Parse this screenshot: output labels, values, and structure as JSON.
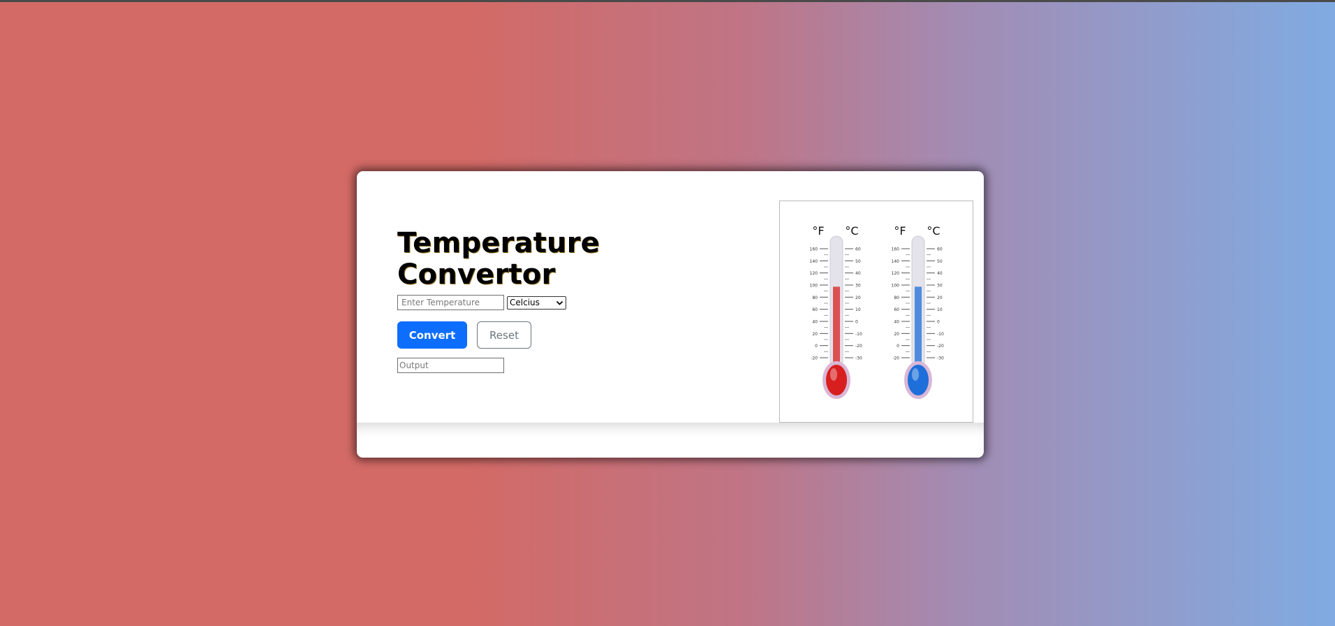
{
  "app": {
    "title": "Temperature Convertor"
  },
  "form": {
    "temperature_placeholder": "Enter Temperature",
    "temperature_value": "",
    "unit_selected": "Celcius",
    "convert_label": "Convert",
    "reset_label": "Reset",
    "output_placeholder": "Output",
    "output_value": ""
  },
  "illustration": {
    "thermometers": [
      {
        "scale_left": "°F",
        "scale_right": "°C",
        "color": "#d81f1f",
        "fill_fraction": 0.68
      },
      {
        "scale_left": "°F",
        "scale_right": "°C",
        "color": "#1e6fd9",
        "fill_fraction": 0.68
      }
    ],
    "fahrenheit_ticks": [
      "160",
      "140",
      "120",
      "100",
      "80",
      "60",
      "40",
      "20",
      "0",
      "-20"
    ],
    "celsius_ticks": [
      "60",
      "50",
      "40",
      "30",
      "20",
      "10",
      "0",
      "-10",
      "-20",
      "-30"
    ]
  },
  "colors": {
    "primary_button": "#0d6efd",
    "background_left": "#d36a66",
    "background_right": "#80abe2"
  }
}
